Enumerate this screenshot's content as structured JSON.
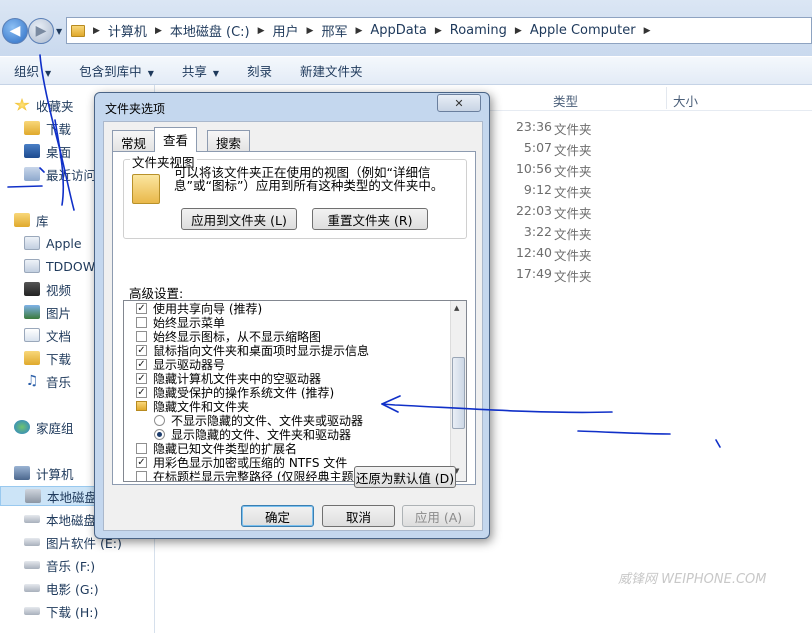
{
  "address": {
    "crumbs": [
      "计算机",
      "本地磁盘 (C:)",
      "用户",
      "邢军",
      "AppData",
      "Roaming",
      "Apple Computer"
    ]
  },
  "commandbar": {
    "organize": "组织",
    "include_library": "包含到库中",
    "share": "共享",
    "burn": "刻录",
    "new_folder": "新建文件夹"
  },
  "nav": {
    "favorites": "收藏夹",
    "downloads": "下载",
    "desktop": "桌面",
    "recent": "最近访问",
    "library": "库",
    "apple": "Apple",
    "tddow": "TDDOW",
    "videos": "视频",
    "pictures": "图片",
    "documents": "文档",
    "lib_downloads": "下载",
    "music": "音乐",
    "homegroup": "家庭组",
    "computer": "计算机",
    "local_disk": "本地磁盘",
    "local_disk2": "本地磁盘",
    "drive_e": "图片软件 (E:)",
    "drive_f": "音乐 (F:)",
    "drive_g": "电影 (G:)",
    "drive_h": "下载 (H:)"
  },
  "columns": {
    "type": "类型",
    "size": "大小"
  },
  "rows": [
    {
      "time": "23:36",
      "type": "文件夹"
    },
    {
      "time": "5:07",
      "type": "文件夹"
    },
    {
      "time": "10:56",
      "type": "文件夹"
    },
    {
      "time": "9:12",
      "type": "文件夹"
    },
    {
      "time": "22:03",
      "type": "文件夹"
    },
    {
      "time": "3:22",
      "type": "文件夹"
    },
    {
      "time": "12:40",
      "type": "文件夹"
    },
    {
      "time": "17:49",
      "type": "文件夹"
    }
  ],
  "dialog": {
    "title": "文件夹选项",
    "tabs": [
      "常规",
      "查看",
      "搜索"
    ],
    "folder_views_title": "文件夹视图",
    "folder_views_desc": "可以将该文件夹正在使用的视图（例如“详细信息”或“图标”）应用到所有这种类型的文件夹中。",
    "apply_to_folders": "应用到文件夹 (L)",
    "reset_folders": "重置文件夹 (R)",
    "advanced_label": "高级设置:",
    "advanced_items": [
      {
        "label": "使用共享向导 (推荐)",
        "kind": "checkbox",
        "checked": true
      },
      {
        "label": "始终显示菜单",
        "kind": "checkbox",
        "checked": false
      },
      {
        "label": "始终显示图标，从不显示缩略图",
        "kind": "checkbox",
        "checked": false
      },
      {
        "label": "鼠标指向文件夹和桌面项时显示提示信息",
        "kind": "checkbox",
        "checked": true
      },
      {
        "label": "显示驱动器号",
        "kind": "checkbox",
        "checked": true
      },
      {
        "label": "隐藏计算机文件夹中的空驱动器",
        "kind": "checkbox",
        "checked": true
      },
      {
        "label": "隐藏受保护的操作系统文件 (推荐)",
        "kind": "checkbox",
        "checked": true
      },
      {
        "label": "隐藏文件和文件夹",
        "kind": "folder"
      },
      {
        "label": "不显示隐藏的文件、文件夹或驱动器",
        "kind": "radio",
        "checked": false
      },
      {
        "label": "显示隐藏的文件、文件夹和驱动器",
        "kind": "radio",
        "checked": true
      },
      {
        "label": "隐藏已知文件类型的扩展名",
        "kind": "checkbox",
        "checked": false
      },
      {
        "label": "用彩色显示加密或压缩的 NTFS 文件",
        "kind": "checkbox",
        "checked": true
      },
      {
        "label": "在标题栏显示完整路径 (仅限经典主题)",
        "kind": "checkbox",
        "checked": false
      }
    ],
    "restore_defaults": "还原为默认值 (D)",
    "ok": "确定",
    "cancel": "取消",
    "apply": "应用 (A)"
  },
  "watermark": "威锋网 WEIPHONE.COM",
  "colors": {
    "annotation": "#1030c8",
    "accent": "#1e395b"
  }
}
